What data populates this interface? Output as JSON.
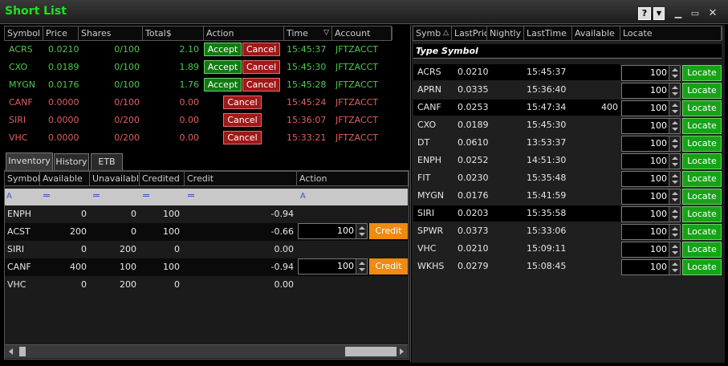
{
  "window": {
    "title": "Short List"
  },
  "orders": {
    "headers": [
      "Symbol",
      "Price",
      "Shares",
      "Total$",
      "Action",
      "Time",
      "Account"
    ],
    "accept_label": "Accept",
    "cancel_label": "Cancel",
    "rows": [
      {
        "symbol": "ACRS",
        "price": "0.0210",
        "shares": "0/100",
        "total": "2.10",
        "time": "15:45:37",
        "account": "JFTZACCT",
        "status": "pending"
      },
      {
        "symbol": "CXO",
        "price": "0.0189",
        "shares": "0/100",
        "total": "1.89",
        "time": "15:45:30",
        "account": "JFTZACCT",
        "status": "pending"
      },
      {
        "symbol": "MYGN",
        "price": "0.0176",
        "shares": "0/100",
        "total": "1.76",
        "time": "15:45:28",
        "account": "JFTZACCT",
        "status": "pending"
      },
      {
        "symbol": "CANF",
        "price": "0.0000",
        "shares": "0/100",
        "total": "0.00",
        "time": "15:45:24",
        "account": "JFTZACCT",
        "status": "open"
      },
      {
        "symbol": "SIRI",
        "price": "0.0000",
        "shares": "0/200",
        "total": "0.00",
        "time": "15:36:07",
        "account": "JFTZACCT",
        "status": "open"
      },
      {
        "symbol": "VHC",
        "price": "0.0000",
        "shares": "0/200",
        "total": "0.00",
        "time": "15:33:21",
        "account": "JFTZACCT",
        "status": "open"
      }
    ]
  },
  "tabs": [
    {
      "label": "Inventory",
      "active": true
    },
    {
      "label": "History",
      "active": false
    },
    {
      "label": "ETB",
      "active": false
    }
  ],
  "inventory": {
    "headers": [
      "Symbol",
      "Available",
      "Unavailable",
      "Credited",
      "Credit",
      "Action"
    ],
    "credit_label": "Credit",
    "rows": [
      {
        "symbol": "ENPH",
        "available": "0",
        "unavailable": "0",
        "credited": "100",
        "credit": "-0.94",
        "qty": null
      },
      {
        "symbol": "ACST",
        "available": "200",
        "unavailable": "0",
        "credited": "100",
        "credit": "-0.66",
        "qty": "100"
      },
      {
        "symbol": "SIRI",
        "available": "0",
        "unavailable": "200",
        "credited": "0",
        "credit": "0.00",
        "qty": null
      },
      {
        "symbol": "CANF",
        "available": "400",
        "unavailable": "100",
        "credited": "100",
        "credit": "-0.94",
        "qty": "100"
      },
      {
        "symbol": "VHC",
        "available": "0",
        "unavailable": "200",
        "credited": "0",
        "credit": "0.00",
        "qty": null
      }
    ]
  },
  "locate": {
    "headers": [
      "Symb",
      "LastPric",
      "Nightly",
      "LastTime",
      "Available",
      "Locate"
    ],
    "type_symbol_label": "Type Symbol",
    "locate_label": "Locate",
    "rows": [
      {
        "symbol": "ACRS",
        "last_price": "0.0210",
        "last_time": "15:45:37",
        "available": "",
        "qty": "100"
      },
      {
        "symbol": "APRN",
        "last_price": "0.0335",
        "last_time": "15:36:40",
        "available": "",
        "qty": "100"
      },
      {
        "symbol": "CANF",
        "last_price": "0.0253",
        "last_time": "15:47:34",
        "available": "400",
        "qty": "100"
      },
      {
        "symbol": "CXO",
        "last_price": "0.0189",
        "last_time": "15:45:30",
        "available": "",
        "qty": "100"
      },
      {
        "symbol": "DT",
        "last_price": "0.0610",
        "last_time": "13:53:37",
        "available": "",
        "qty": "100"
      },
      {
        "symbol": "ENPH",
        "last_price": "0.0252",
        "last_time": "14:51:30",
        "available": "",
        "qty": "100"
      },
      {
        "symbol": "FIT",
        "last_price": "0.0230",
        "last_time": "15:35:48",
        "available": "",
        "qty": "100"
      },
      {
        "symbol": "MYGN",
        "last_price": "0.0176",
        "last_time": "15:41:59",
        "available": "",
        "qty": "100"
      },
      {
        "symbol": "SIRI",
        "last_price": "0.0203",
        "last_time": "15:35:58",
        "available": "",
        "qty": "100"
      },
      {
        "symbol": "SPWR",
        "last_price": "0.0373",
        "last_time": "15:33:06",
        "available": "",
        "qty": "100"
      },
      {
        "symbol": "VHC",
        "last_price": "0.0210",
        "last_time": "15:09:11",
        "available": "",
        "qty": "100"
      },
      {
        "symbol": "WKHS",
        "last_price": "0.0279",
        "last_time": "15:08:45",
        "available": "",
        "qty": "100"
      }
    ]
  },
  "colors": {
    "title": "#19e619",
    "pending_text": "#4ec94e",
    "open_text": "#e06060",
    "accept": "#127a12",
    "cancel": "#a01818",
    "credit": "#f08a10",
    "locate": "#16a316"
  }
}
